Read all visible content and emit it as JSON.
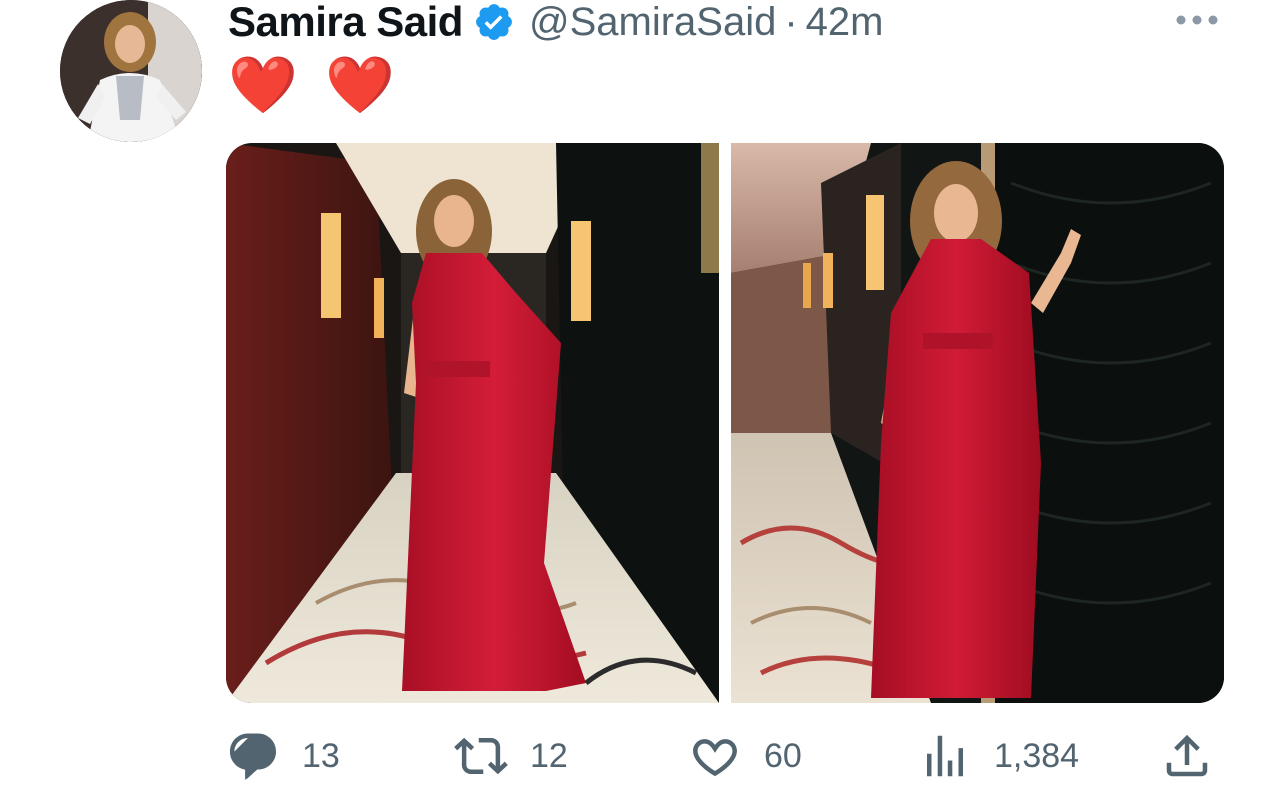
{
  "tweet": {
    "display_name": "Samira Said",
    "handle": "@SamiraSaid",
    "separator": "·",
    "timestamp": "42m",
    "text": "❤️ ❤️"
  },
  "icons": {
    "verified": "verified-badge-icon",
    "more": "more-options-icon",
    "reply": "reply-icon",
    "retweet": "retweet-icon",
    "like": "like-icon",
    "views": "views-icon",
    "share": "share-icon"
  },
  "media": {
    "photo_count": 2
  },
  "actions": {
    "replies": "13",
    "retweets": "12",
    "likes": "60",
    "views": "1,384"
  },
  "colors": {
    "verified_blue": "#1d9bf0",
    "secondary_text": "#536471",
    "heart_red": "#e0245e",
    "dress_red": "#c8102e"
  }
}
